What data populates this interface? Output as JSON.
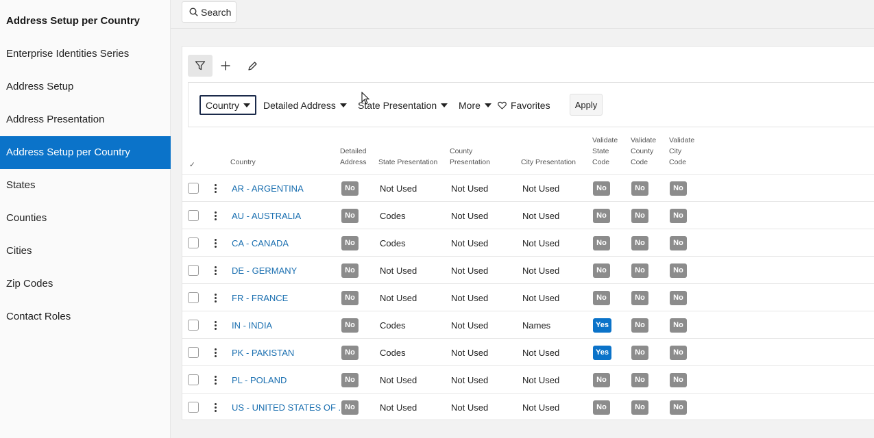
{
  "sidebar": {
    "title": "Address Setup per Country",
    "items": [
      {
        "label": "Enterprise Identities Series",
        "active": false
      },
      {
        "label": "Address Setup",
        "active": false
      },
      {
        "label": "Address Presentation",
        "active": false
      },
      {
        "label": "Address Setup per Country",
        "active": true
      },
      {
        "label": "States",
        "active": false
      },
      {
        "label": "Counties",
        "active": false
      },
      {
        "label": "Cities",
        "active": false
      },
      {
        "label": "Zip Codes",
        "active": false
      },
      {
        "label": "Contact Roles",
        "active": false
      }
    ]
  },
  "search": {
    "label": "Search",
    "icon": "search-icon"
  },
  "toolbar": {
    "icons": [
      "filter-icon",
      "plus-icon",
      "pencil-icon"
    ]
  },
  "filters": {
    "country": "Country",
    "detailed_address": "Detailed Address",
    "state_presentation": "State Presentation",
    "more": "More",
    "favorites": "Favorites",
    "apply": "Apply"
  },
  "table": {
    "headers": {
      "check": "✓",
      "country": "Country",
      "detailed_address": [
        "Detailed",
        "Address"
      ],
      "state_presentation": "State Presentation",
      "county_presentation": [
        "County",
        "Presentation"
      ],
      "city_presentation": "City Presentation",
      "validate_state": [
        "Validate",
        "State",
        "Code"
      ],
      "validate_county": [
        "Validate",
        "County",
        "Code"
      ],
      "validate_city": [
        "Validate",
        "City",
        "Code"
      ]
    },
    "rows": [
      {
        "country": "AR - ARGENTINA",
        "detailed": "No",
        "state": "Not Used",
        "county": "Not Used",
        "city": "Not Used",
        "v_state": "No",
        "v_county": "No",
        "v_city": "No"
      },
      {
        "country": "AU - AUSTRALIA",
        "detailed": "No",
        "state": "Codes",
        "county": "Not Used",
        "city": "Not Used",
        "v_state": "No",
        "v_county": "No",
        "v_city": "No"
      },
      {
        "country": "CA - CANADA",
        "detailed": "No",
        "state": "Codes",
        "county": "Not Used",
        "city": "Not Used",
        "v_state": "No",
        "v_county": "No",
        "v_city": "No"
      },
      {
        "country": "DE - GERMANY",
        "detailed": "No",
        "state": "Not Used",
        "county": "Not Used",
        "city": "Not Used",
        "v_state": "No",
        "v_county": "No",
        "v_city": "No"
      },
      {
        "country": "FR - FRANCE",
        "detailed": "No",
        "state": "Not Used",
        "county": "Not Used",
        "city": "Not Used",
        "v_state": "No",
        "v_county": "No",
        "v_city": "No"
      },
      {
        "country": "IN - INDIA",
        "detailed": "No",
        "state": "Codes",
        "county": "Not Used",
        "city": "Names",
        "v_state": "Yes",
        "v_county": "No",
        "v_city": "No"
      },
      {
        "country": "PK - PAKISTAN",
        "detailed": "No",
        "state": "Codes",
        "county": "Not Used",
        "city": "Not Used",
        "v_state": "Yes",
        "v_county": "No",
        "v_city": "No"
      },
      {
        "country": "PL - POLAND",
        "detailed": "No",
        "state": "Not Used",
        "county": "Not Used",
        "city": "Not Used",
        "v_state": "No",
        "v_county": "No",
        "v_city": "No"
      },
      {
        "country": "US - UNITED STATES OF ...",
        "detailed": "No",
        "state": "Not Used",
        "county": "Not Used",
        "city": "Not Used",
        "v_state": "No",
        "v_county": "No",
        "v_city": "No"
      }
    ]
  },
  "colors": {
    "accent": "#0b73c9",
    "badge_no": "#8c8c8c",
    "link": "#1a6fb0"
  }
}
